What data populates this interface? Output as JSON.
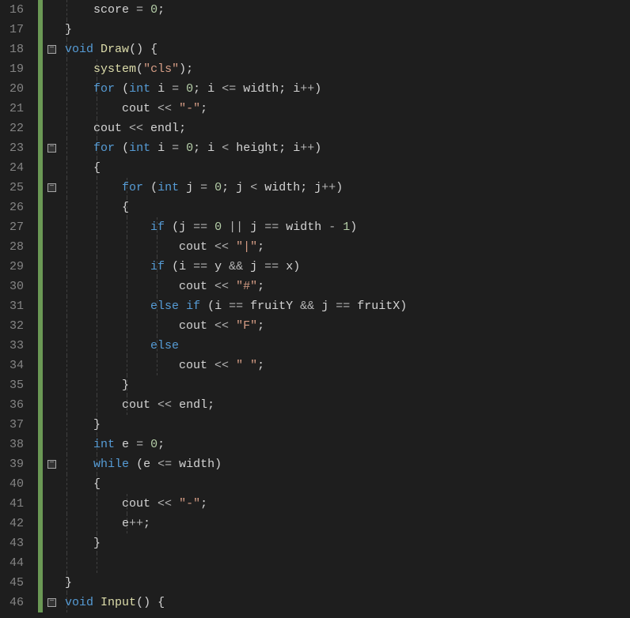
{
  "editor": {
    "first_line": 16,
    "line_height_px": 25,
    "colors": {
      "background": "#1e1e1e",
      "line_number": "#858585",
      "change_marker": "#6b9955",
      "keyword": "#569cd6",
      "function": "#dcdcaa",
      "identifier": "#d4d4d4",
      "number": "#b5cea8",
      "string": "#d69d85",
      "operator": "#b4b4b4"
    },
    "fold_markers": [
      {
        "line": 18,
        "glyph": "−"
      },
      {
        "line": 23,
        "glyph": "−"
      },
      {
        "line": 25,
        "glyph": "−"
      },
      {
        "line": 39,
        "glyph": "−"
      },
      {
        "line": 46,
        "glyph": "−"
      }
    ],
    "lines": [
      {
        "n": 16,
        "indent": 1,
        "tokens": [
          [
            "id",
            "    score "
          ],
          [
            "op",
            "="
          ],
          [
            "id",
            " "
          ],
          [
            "num",
            "0"
          ],
          [
            "pn",
            ";"
          ]
        ]
      },
      {
        "n": 17,
        "indent": 1,
        "tokens": [
          [
            "pn",
            "}"
          ]
        ]
      },
      {
        "n": 18,
        "indent": 1,
        "tokens": [
          [
            "kw",
            "void"
          ],
          [
            "id",
            " "
          ],
          [
            "fn",
            "Draw"
          ],
          [
            "pn",
            "()"
          ],
          [
            "id",
            " "
          ],
          [
            "pn",
            "{"
          ]
        ]
      },
      {
        "n": 19,
        "indent": 2,
        "tokens": [
          [
            "id",
            "    "
          ],
          [
            "fn",
            "system"
          ],
          [
            "pn",
            "("
          ],
          [
            "str",
            "\"cls\""
          ],
          [
            "pn",
            ")"
          ],
          [
            "pn",
            ";"
          ]
        ]
      },
      {
        "n": 20,
        "indent": 2,
        "tokens": [
          [
            "id",
            "    "
          ],
          [
            "kw",
            "for"
          ],
          [
            "id",
            " "
          ],
          [
            "pn",
            "("
          ],
          [
            "kw",
            "int"
          ],
          [
            "id",
            " i "
          ],
          [
            "op",
            "="
          ],
          [
            "id",
            " "
          ],
          [
            "num",
            "0"
          ],
          [
            "pn",
            "; "
          ],
          [
            "id",
            "i "
          ],
          [
            "op",
            "<="
          ],
          [
            "id",
            " width"
          ],
          [
            "pn",
            "; "
          ],
          [
            "id",
            "i"
          ],
          [
            "op",
            "++"
          ],
          [
            "pn",
            ")"
          ]
        ]
      },
      {
        "n": 21,
        "indent": 2,
        "tokens": [
          [
            "id",
            "        cout "
          ],
          [
            "op",
            "<<"
          ],
          [
            "id",
            " "
          ],
          [
            "str",
            "\"-\""
          ],
          [
            "pn",
            ";"
          ]
        ]
      },
      {
        "n": 22,
        "indent": 2,
        "tokens": [
          [
            "id",
            "    cout "
          ],
          [
            "op",
            "<<"
          ],
          [
            "id",
            " endl"
          ],
          [
            "pn",
            ";"
          ]
        ]
      },
      {
        "n": 23,
        "indent": 2,
        "tokens": [
          [
            "id",
            "    "
          ],
          [
            "kw",
            "for"
          ],
          [
            "id",
            " "
          ],
          [
            "pn",
            "("
          ],
          [
            "kw",
            "int"
          ],
          [
            "id",
            " i "
          ],
          [
            "op",
            "="
          ],
          [
            "id",
            " "
          ],
          [
            "num",
            "0"
          ],
          [
            "pn",
            "; "
          ],
          [
            "id",
            "i "
          ],
          [
            "op",
            "<"
          ],
          [
            "id",
            " height"
          ],
          [
            "pn",
            "; "
          ],
          [
            "id",
            "i"
          ],
          [
            "op",
            "++"
          ],
          [
            "pn",
            ")"
          ]
        ]
      },
      {
        "n": 24,
        "indent": 2,
        "tokens": [
          [
            "id",
            "    "
          ],
          [
            "pn",
            "{"
          ]
        ]
      },
      {
        "n": 25,
        "indent": 3,
        "tokens": [
          [
            "id",
            "        "
          ],
          [
            "kw",
            "for"
          ],
          [
            "id",
            " "
          ],
          [
            "pn",
            "("
          ],
          [
            "kw",
            "int"
          ],
          [
            "id",
            " j "
          ],
          [
            "op",
            "="
          ],
          [
            "id",
            " "
          ],
          [
            "num",
            "0"
          ],
          [
            "pn",
            "; "
          ],
          [
            "id",
            "j "
          ],
          [
            "op",
            "<"
          ],
          [
            "id",
            " width"
          ],
          [
            "pn",
            "; "
          ],
          [
            "id",
            "j"
          ],
          [
            "op",
            "++"
          ],
          [
            "pn",
            ")"
          ]
        ]
      },
      {
        "n": 26,
        "indent": 3,
        "tokens": [
          [
            "id",
            "        "
          ],
          [
            "pn",
            "{"
          ]
        ]
      },
      {
        "n": 27,
        "indent": 4,
        "tokens": [
          [
            "id",
            "            "
          ],
          [
            "kw",
            "if"
          ],
          [
            "id",
            " "
          ],
          [
            "pn",
            "("
          ],
          [
            "id",
            "j "
          ],
          [
            "op",
            "=="
          ],
          [
            "id",
            " "
          ],
          [
            "num",
            "0"
          ],
          [
            "id",
            " "
          ],
          [
            "op",
            "||"
          ],
          [
            "id",
            " j "
          ],
          [
            "op",
            "=="
          ],
          [
            "id",
            " width "
          ],
          [
            "op",
            "-"
          ],
          [
            "id",
            " "
          ],
          [
            "num",
            "1"
          ],
          [
            "pn",
            ")"
          ]
        ]
      },
      {
        "n": 28,
        "indent": 4,
        "tokens": [
          [
            "id",
            "                cout "
          ],
          [
            "op",
            "<<"
          ],
          [
            "id",
            " "
          ],
          [
            "str",
            "\"|\""
          ],
          [
            "pn",
            ";"
          ]
        ]
      },
      {
        "n": 29,
        "indent": 4,
        "tokens": [
          [
            "id",
            "            "
          ],
          [
            "kw",
            "if"
          ],
          [
            "id",
            " "
          ],
          [
            "pn",
            "("
          ],
          [
            "id",
            "i "
          ],
          [
            "op",
            "=="
          ],
          [
            "id",
            " y "
          ],
          [
            "op",
            "&&"
          ],
          [
            "id",
            " j "
          ],
          [
            "op",
            "=="
          ],
          [
            "id",
            " x"
          ],
          [
            "pn",
            ")"
          ]
        ]
      },
      {
        "n": 30,
        "indent": 4,
        "tokens": [
          [
            "id",
            "                cout "
          ],
          [
            "op",
            "<<"
          ],
          [
            "id",
            " "
          ],
          [
            "str",
            "\"#\""
          ],
          [
            "pn",
            ";"
          ]
        ]
      },
      {
        "n": 31,
        "indent": 4,
        "tokens": [
          [
            "id",
            "            "
          ],
          [
            "kw",
            "else"
          ],
          [
            "id",
            " "
          ],
          [
            "kw",
            "if"
          ],
          [
            "id",
            " "
          ],
          [
            "pn",
            "("
          ],
          [
            "id",
            "i "
          ],
          [
            "op",
            "=="
          ],
          [
            "id",
            " fruitY "
          ],
          [
            "op",
            "&&"
          ],
          [
            "id",
            " j "
          ],
          [
            "op",
            "=="
          ],
          [
            "id",
            " fruitX"
          ],
          [
            "pn",
            ")"
          ]
        ]
      },
      {
        "n": 32,
        "indent": 4,
        "tokens": [
          [
            "id",
            "                cout "
          ],
          [
            "op",
            "<<"
          ],
          [
            "id",
            " "
          ],
          [
            "str",
            "\"F\""
          ],
          [
            "pn",
            ";"
          ]
        ]
      },
      {
        "n": 33,
        "indent": 4,
        "tokens": [
          [
            "id",
            "            "
          ],
          [
            "kw",
            "else"
          ]
        ]
      },
      {
        "n": 34,
        "indent": 4,
        "tokens": [
          [
            "id",
            "                cout "
          ],
          [
            "op",
            "<<"
          ],
          [
            "id",
            " "
          ],
          [
            "str",
            "\" \""
          ],
          [
            "pn",
            ";"
          ]
        ]
      },
      {
        "n": 35,
        "indent": 3,
        "tokens": [
          [
            "id",
            "        "
          ],
          [
            "pn",
            "}"
          ]
        ]
      },
      {
        "n": 36,
        "indent": 3,
        "tokens": [
          [
            "id",
            "        cout "
          ],
          [
            "op",
            "<<"
          ],
          [
            "id",
            " endl"
          ],
          [
            "pn",
            ";"
          ]
        ]
      },
      {
        "n": 37,
        "indent": 2,
        "tokens": [
          [
            "id",
            "    "
          ],
          [
            "pn",
            "}"
          ]
        ]
      },
      {
        "n": 38,
        "indent": 2,
        "tokens": [
          [
            "id",
            "    "
          ],
          [
            "kw",
            "int"
          ],
          [
            "id",
            " e "
          ],
          [
            "op",
            "="
          ],
          [
            "id",
            " "
          ],
          [
            "num",
            "0"
          ],
          [
            "pn",
            ";"
          ]
        ]
      },
      {
        "n": 39,
        "indent": 2,
        "tokens": [
          [
            "id",
            "    "
          ],
          [
            "kw",
            "while"
          ],
          [
            "id",
            " "
          ],
          [
            "pn",
            "("
          ],
          [
            "id",
            "e "
          ],
          [
            "op",
            "<="
          ],
          [
            "id",
            " width"
          ],
          [
            "pn",
            ")"
          ]
        ]
      },
      {
        "n": 40,
        "indent": 2,
        "tokens": [
          [
            "id",
            "    "
          ],
          [
            "pn",
            "{"
          ]
        ]
      },
      {
        "n": 41,
        "indent": 3,
        "tokens": [
          [
            "id",
            "        cout "
          ],
          [
            "op",
            "<<"
          ],
          [
            "id",
            " "
          ],
          [
            "str",
            "\"-\""
          ],
          [
            "pn",
            ";"
          ]
        ]
      },
      {
        "n": 42,
        "indent": 3,
        "tokens": [
          [
            "id",
            "        e"
          ],
          [
            "op",
            "++"
          ],
          [
            "pn",
            ";"
          ]
        ]
      },
      {
        "n": 43,
        "indent": 2,
        "tokens": [
          [
            "id",
            "    "
          ],
          [
            "pn",
            "}"
          ]
        ]
      },
      {
        "n": 44,
        "indent": 2,
        "tokens": []
      },
      {
        "n": 45,
        "indent": 1,
        "tokens": [
          [
            "pn",
            "}"
          ]
        ]
      },
      {
        "n": 46,
        "indent": 1,
        "tokens": [
          [
            "kw",
            "void"
          ],
          [
            "id",
            " "
          ],
          [
            "fn",
            "Input"
          ],
          [
            "pn",
            "()"
          ],
          [
            "id",
            " "
          ],
          [
            "pn",
            "{"
          ]
        ]
      }
    ]
  }
}
